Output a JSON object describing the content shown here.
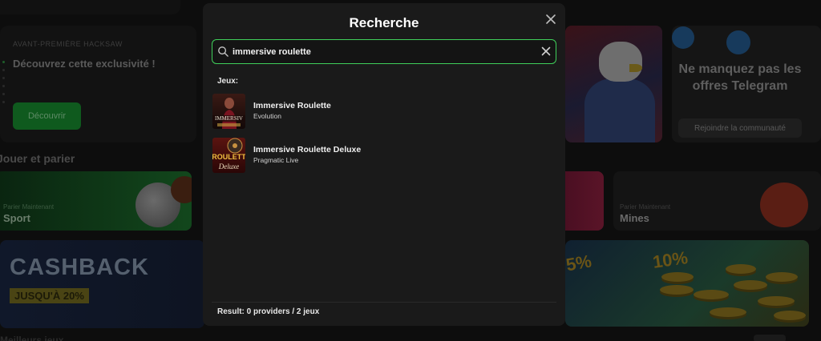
{
  "background": {
    "promo": {
      "eyebrow": "AVANT-PREMIÈRE HACKSAW",
      "title": "Découvrez cette exclusivité !",
      "button_label": "Découvrir"
    },
    "section_title": "Jouer et parier",
    "tiles": [
      {
        "small": "Parier Maintenant",
        "big": "Sport"
      },
      {
        "small": "Parier Maintenant",
        "big": "Mines"
      }
    ],
    "cashback": {
      "title": "CASHBACK",
      "badge": "JUSQU'À 20%"
    },
    "telegram": {
      "title": "Ne manquez pas les offres Telegram",
      "button_label": "Rejoindre la communauté"
    },
    "percent_a": "5%",
    "percent_b": "10%",
    "bottom_section": "Meilleurs jeux"
  },
  "modal": {
    "title": "Recherche",
    "search": {
      "value": "immersive roulette",
      "placeholder": ""
    },
    "section_label": "Jeux:",
    "results": [
      {
        "name": "Immersive Roulette",
        "provider": "Evolution",
        "thumb_text": "IMMERSIV"
      },
      {
        "name": "Immersive Roulette Deluxe",
        "provider": "Pragmatic Live",
        "thumb_text_a": "ROULETT",
        "thumb_text_b": "Deluxe"
      }
    ],
    "footer": "Result: 0 providers / 2 jeux"
  },
  "colors": {
    "accent": "#3fcf5a",
    "modal_bg": "#1a1a1a",
    "page_bg": "#0d0d0d"
  }
}
